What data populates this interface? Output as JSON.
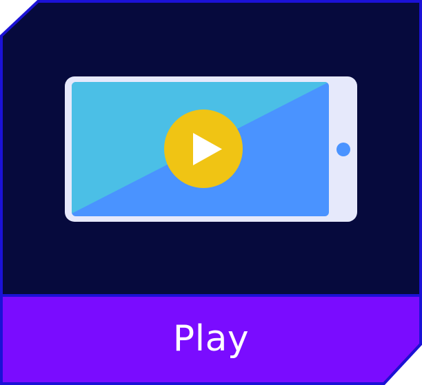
{
  "tile": {
    "label": "Play",
    "icon": "video-play-phone-icon"
  },
  "colors": {
    "panel_bg": "#060a3d",
    "border": "#1b12d6",
    "label_bg": "#7a0cff",
    "label_text": "#ffffff",
    "phone_body": "#e6e9fb",
    "screen_light": "#4bbfe6",
    "screen_dark": "#4a93ff",
    "home_button": "#4a93ff",
    "play_circle": "#f0c414",
    "play_triangle": "#ffffff"
  }
}
